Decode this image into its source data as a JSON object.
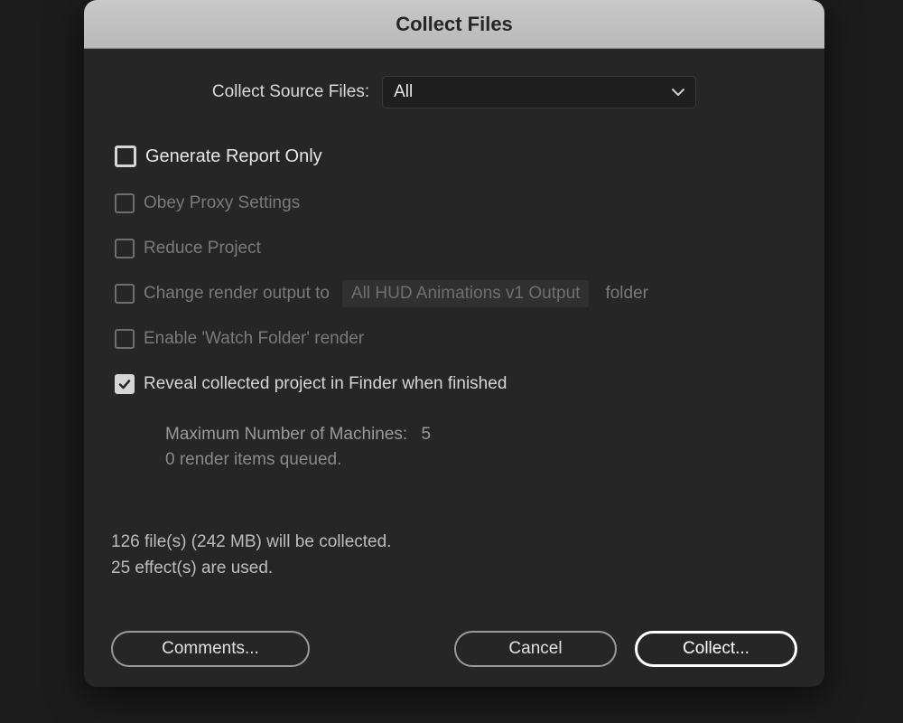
{
  "dialog": {
    "title": "Collect Files"
  },
  "source": {
    "label": "Collect Source Files:",
    "selected": "All"
  },
  "options": {
    "generate_report": "Generate Report Only",
    "obey_proxy": "Obey Proxy Settings",
    "reduce_project": "Reduce Project",
    "change_output_prefix": "Change render output to",
    "change_output_value": "All HUD Animations v1 Output",
    "change_output_suffix": "folder",
    "enable_watch": "Enable 'Watch Folder' render",
    "reveal_finder": "Reveal collected project in Finder when finished"
  },
  "machines": {
    "label": "Maximum Number of Machines:",
    "value": "5",
    "queued": "0 render items queued."
  },
  "summary": {
    "line1": "126 file(s) (242 MB) will be collected.",
    "line2": "25 effect(s) are used."
  },
  "buttons": {
    "comments": "Comments...",
    "cancel": "Cancel",
    "collect": "Collect..."
  }
}
